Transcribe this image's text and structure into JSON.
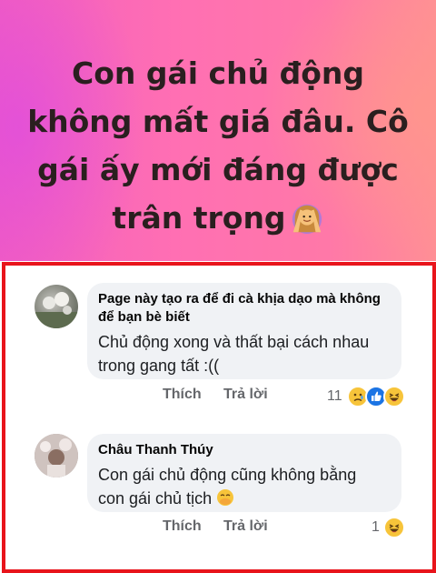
{
  "post": {
    "text": "Con gái chủ động không mất giá đâu. Cô gái ấy mới đáng được trân trọng",
    "emoji": "person-gesturing-ok-icon"
  },
  "comments": [
    {
      "author": "Page này tạo ra để đi cà khịa dạo mà không để bạn bè biết",
      "text": "Chủ động xong và thất bại cách nhau trong gang tất :((",
      "like_label": "Thích",
      "reply_label": "Trả lời",
      "reaction_count": "11",
      "reactions": [
        "sad-reaction-icon",
        "like-reaction-icon",
        "haha-reaction-icon"
      ]
    },
    {
      "author": "Châu Thanh Thúy",
      "text": "Con gái chủ động cũng không bằng con gái chủ tịch",
      "emoji": "smiling-face-with-hand-over-mouth-icon",
      "like_label": "Thích",
      "reply_label": "Trả lời",
      "reaction_count": "1",
      "reactions": [
        "haha-reaction-icon"
      ]
    }
  ],
  "colors": {
    "frame": "#e8141b",
    "bubble": "#f0f2f5",
    "like_blue": "#1b74e4"
  }
}
